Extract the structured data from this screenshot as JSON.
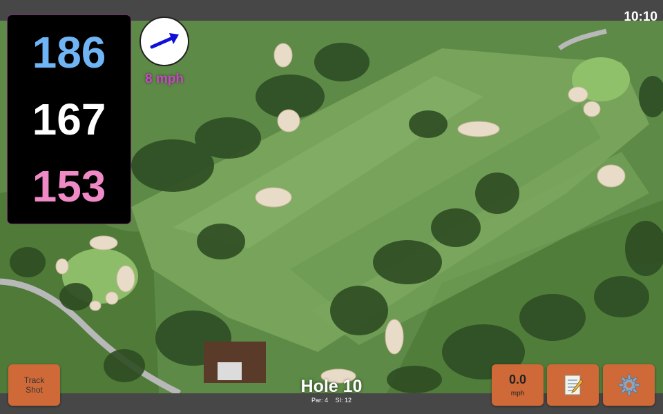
{
  "status": {
    "time": "10:10"
  },
  "distances": {
    "back": "186",
    "center": "167",
    "front": "153"
  },
  "colors": {
    "back": "#6fb4f4",
    "center": "#ffffff",
    "front": "#ef8ac7",
    "wind_text": "#cb48c9",
    "button": "#cf6a38"
  },
  "wind": {
    "speed_label": "8 mph",
    "icon": "arrow-up-right-icon"
  },
  "buttons": {
    "track_line1": "Track",
    "track_line2": "Shot",
    "speed_value": "0.0",
    "speed_unit": "mph",
    "notes_icon": "memo-icon",
    "settings_icon": "gear-icon"
  },
  "hole": {
    "title": "Hole 10",
    "par": "Par: 4",
    "si": "SI: 12"
  }
}
